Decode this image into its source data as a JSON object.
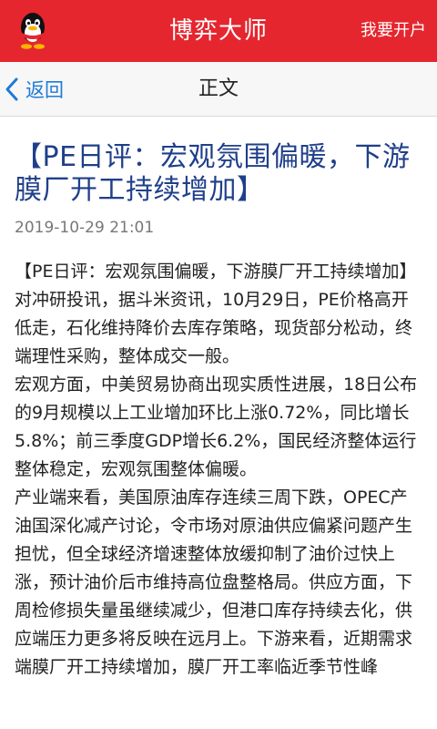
{
  "header": {
    "title": "博弈大师",
    "action_label": "我要开户",
    "bg_color": "#e5262e"
  },
  "nav": {
    "back_label": "返回",
    "title": "正文",
    "accent_color": "#1e7ad6"
  },
  "article": {
    "title": "【PE日评：宏观氛围偏暖，下游膜厂开工持续增加】",
    "date": "2019-10-29 21:01",
    "paragraphs": [
      "【PE日评：宏观氛围偏暖，下游膜厂开工持续增加】对冲研投讯，据斗米资讯，10月29日，PE价格高开低走，石化维持降价去库存策略，现货部分松动，终端理性采购，整体成交一般。",
      "宏观方面，中美贸易协商出现实质性进展，18日公布的9月规模以上工业增加环比上涨0.72%，同比增长5.8%；前三季度GDP增长6.2%，国民经济整体运行整体稳定，宏观氛围整体偏暖。",
      "产业端来看，美国原油库存连续三周下跌，OPEC产油国深化减产讨论，令市场对原油供应偏紧问题产生担忧，但全球经济增速整体放缓抑制了油价过快上涨，预计油价后市维持高位盘整格局。供应方面，下周检修损失量虽继续减少，但港口库存持续去化，供应端压力更多将反映在远月上。下游来看，近期需求端膜厂开工持续增加，膜厂开工率临近季节性峰"
    ]
  }
}
